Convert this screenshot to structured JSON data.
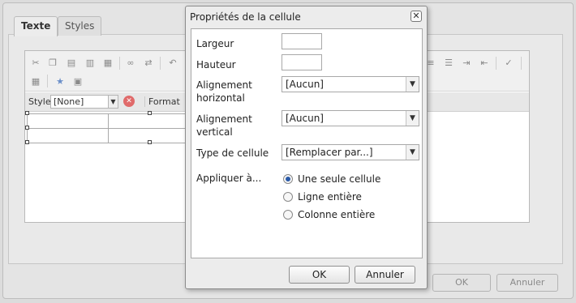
{
  "background_editor": {
    "tabs": [
      {
        "label": "Texte",
        "active": true
      },
      {
        "label": "Styles",
        "active": false
      }
    ],
    "style_label": "Style",
    "style_value": "[None]",
    "format_label": "Format",
    "ok_label": "OK",
    "cancel_label": "Annuler"
  },
  "dialog": {
    "title": "Propriétés de la cellule",
    "fields": {
      "largeur": {
        "label": "Largeur",
        "value": ""
      },
      "hauteur": {
        "label": "Hauteur",
        "value": ""
      },
      "align_h": {
        "label_line1": "Alignement",
        "label_line2": "horizontal",
        "value": "[Aucun]"
      },
      "align_v": {
        "label_line1": "Alignement",
        "label_line2": "vertical",
        "value": "[Aucun]"
      },
      "cell_type": {
        "label": "Type de cellule",
        "value": "[Remplacer par...]"
      }
    },
    "apply_to": {
      "label": "Appliquer à...",
      "options": [
        {
          "label": "Une seule cellule",
          "selected": true
        },
        {
          "label": "Ligne entière",
          "selected": false
        },
        {
          "label": "Colonne entière",
          "selected": false
        }
      ]
    },
    "ok_label": "OK",
    "cancel_label": "Annuler"
  },
  "colors": {
    "radio_selected": "#2a5aa8",
    "clear_icon": "#e06a6a"
  }
}
